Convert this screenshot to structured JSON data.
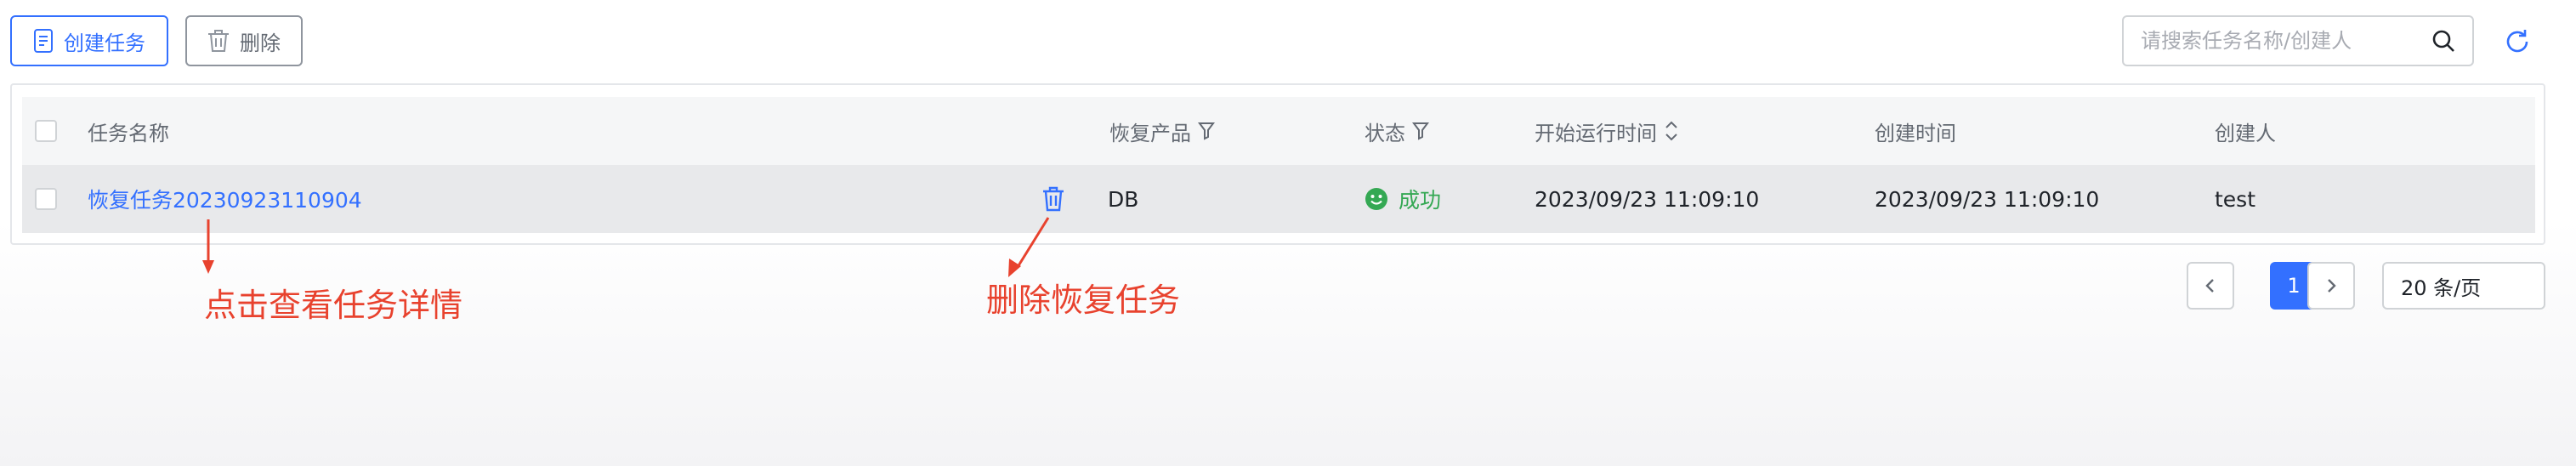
{
  "toolbar": {
    "create_label": "创建任务",
    "delete_label": "删除"
  },
  "search": {
    "placeholder": "请搜索任务名称/创建人",
    "value": ""
  },
  "table": {
    "columns": {
      "name": "任务名称",
      "product": "恢复产品",
      "status": "状态",
      "start_time": "开始运行时间",
      "created_time": "创建时间",
      "creator": "创建人"
    },
    "rows": [
      {
        "name": "恢复任务20230923110904",
        "product": "DB",
        "status": "成功",
        "start_time": "2023/09/23 11:09:10",
        "created_time": "2023/09/23 11:09:10",
        "creator": "test"
      }
    ]
  },
  "annotations": {
    "view_detail": "点击查看任务详情",
    "delete_task": "删除恢复任务"
  },
  "pagination": {
    "current_page": "1",
    "page_size": "20 条/页"
  },
  "colors": {
    "accent": "#3370ff",
    "success": "#34a853",
    "annotation": "#e8422e"
  },
  "icons": [
    "document-icon",
    "trash-icon",
    "search-icon",
    "refresh-icon",
    "filter-icon",
    "sort-icon",
    "smile-icon",
    "chevron-left-icon",
    "chevron-right-icon"
  ]
}
